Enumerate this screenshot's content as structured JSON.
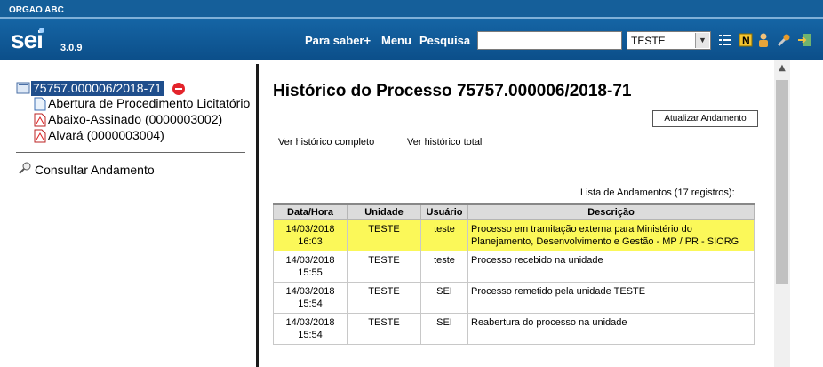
{
  "topbar": {
    "org": "ORGAO ABC"
  },
  "header": {
    "logo": "sei",
    "version": "3.0.9",
    "nav": [
      "Para saber+",
      "Menu",
      "Pesquisa"
    ],
    "search_value": "",
    "unit_selected": "TESTE"
  },
  "tree": {
    "process": "75757.000006/2018-71",
    "documents": [
      {
        "label": "Abertura de Procedimento Licitatório",
        "icon": "document-icon"
      },
      {
        "label": "Abaixo-Assinado (0000003002)",
        "icon": "pdf-icon"
      },
      {
        "label": "Alvará (0000003004)",
        "icon": "pdf-icon"
      }
    ],
    "consult": "Consultar Andamento"
  },
  "main": {
    "title": "Histórico do Processo 75757.000006/2018-71",
    "update_button": "Atualizar Andamento",
    "link_full": "Ver histórico completo",
    "link_total": "Ver histórico total",
    "caption": "Lista de Andamentos (17 registros):",
    "columns": [
      "Data/Hora",
      "Unidade",
      "Usuário",
      "Descrição"
    ],
    "rows": [
      {
        "date": "14/03/2018",
        "time": "16:03",
        "unit": "TESTE",
        "user": "teste",
        "desc": "Processo em tramitação externa para Ministério do Planejamento, Desenvolvimento e Gestão - MP / PR - SIORG"
      },
      {
        "date": "14/03/2018",
        "time": "15:55",
        "unit": "TESTE",
        "user": "teste",
        "desc": "Processo recebido na unidade"
      },
      {
        "date": "14/03/2018",
        "time": "15:54",
        "unit": "TESTE",
        "user": "SEI",
        "desc": "Processo remetido pela unidade TESTE"
      },
      {
        "date": "14/03/2018",
        "time": "15:54",
        "unit": "TESTE",
        "user": "SEI",
        "desc": "Reabertura do processo na unidade"
      }
    ]
  },
  "colors": {
    "header": "#1565a5",
    "highlight": "#fbf859",
    "selected": "#1f4e8c"
  }
}
